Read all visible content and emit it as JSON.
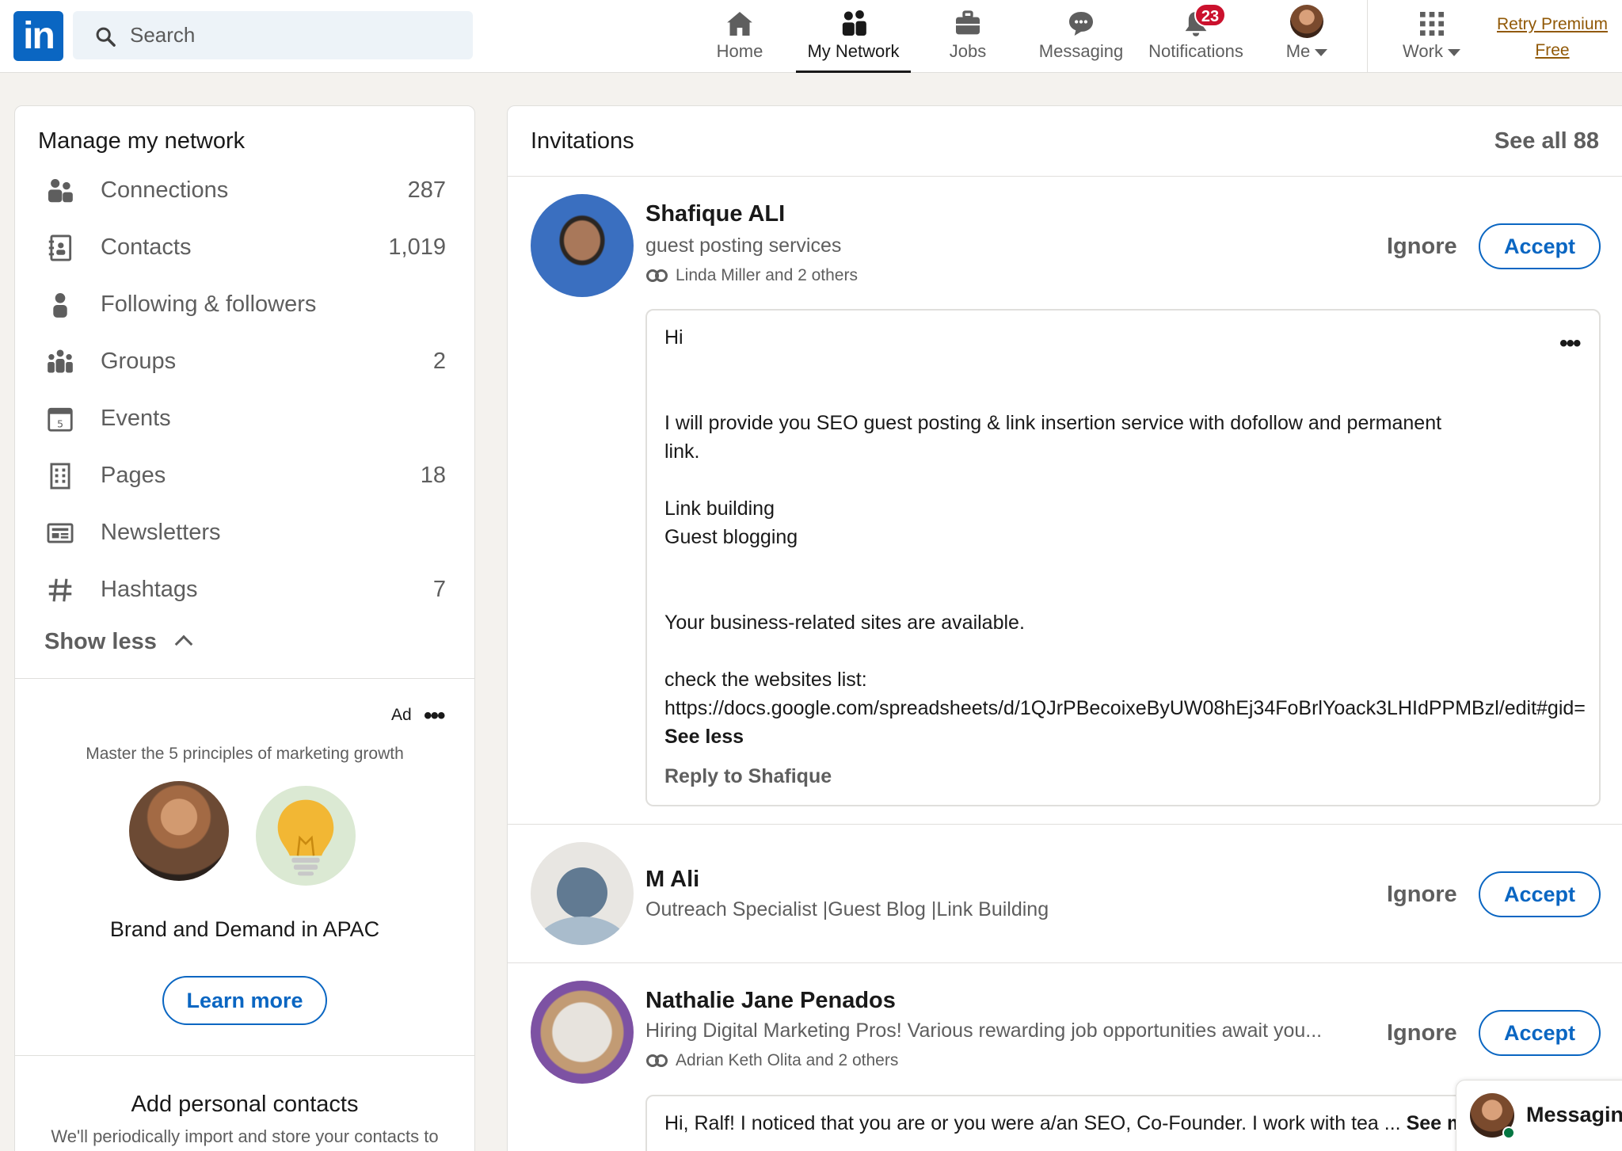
{
  "colors": {
    "brand": "#0a66c2",
    "badge": "#cb112d",
    "premium": "#915907",
    "background": "#f4f2ee"
  },
  "header": {
    "logo": "in",
    "search_placeholder": "Search",
    "nav": [
      {
        "label": "Home",
        "icon": "home-icon"
      },
      {
        "label": "My Network",
        "icon": "network-icon",
        "active": true
      },
      {
        "label": "Jobs",
        "icon": "briefcase-icon"
      },
      {
        "label": "Messaging",
        "icon": "chat-icon"
      },
      {
        "label": "Notifications",
        "icon": "bell-icon",
        "badge": "23"
      },
      {
        "label": "Me",
        "icon": "avatar"
      },
      {
        "label": "Work",
        "icon": "grid-icon"
      }
    ],
    "premium": {
      "line1": "Retry Premium",
      "line2": "Free"
    }
  },
  "sidebar": {
    "title": "Manage my network",
    "items": [
      {
        "label": "Connections",
        "count": "287",
        "icon": "people-icon"
      },
      {
        "label": "Contacts",
        "count": "1,019",
        "icon": "contact-book-icon"
      },
      {
        "label": "Following & followers",
        "count": "",
        "icon": "person-icon"
      },
      {
        "label": "Groups",
        "count": "2",
        "icon": "group-icon"
      },
      {
        "label": "Events",
        "count": "",
        "icon": "calendar-icon"
      },
      {
        "label": "Pages",
        "count": "18",
        "icon": "building-icon"
      },
      {
        "label": "Newsletters",
        "count": "",
        "icon": "newspaper-icon"
      },
      {
        "label": "Hashtags",
        "count": "7",
        "icon": "hashtag-icon"
      }
    ],
    "show_less": "Show less",
    "ad": {
      "label": "Ad",
      "headline": "Master the 5 principles of marketing growth",
      "brand": "Brand and Demand in APAC",
      "cta": "Learn more"
    },
    "contacts_title": "Add personal contacts",
    "contacts_sub": "We'll periodically import and store your contacts to"
  },
  "invitations": {
    "title": "Invitations",
    "see_all": "See all 88",
    "ignore_label": "Ignore",
    "accept_label": "Accept",
    "items": [
      {
        "name": "Shafique ALI",
        "headline": "guest posting services",
        "mutual": "Linda Miller and 2 others",
        "message": {
          "lines": [
            "Hi",
            "I will provide you SEO guest posting & link insertion service with dofollow and permanent",
            "link.",
            "Link building",
            "Guest blogging",
            "Your business-related sites are available.",
            "check the websites list:",
            "https://docs.google.com/spreadsheets/d/1QJrPBecoixeByUW08hEj34FoBrlYoack3LHIdPPMBzl/edit#gid="
          ],
          "see_less": "See less",
          "reply": "Reply to Shafique"
        }
      },
      {
        "name": "M Ali",
        "headline": "Outreach Specialist |Guest Blog |Link Building",
        "mutual": ""
      },
      {
        "name": "Nathalie Jane Penados",
        "headline": "Hiring Digital Marketing Pros! Various rewarding job opportunities await you...",
        "mutual": "Adrian Keth Olita and 2 others",
        "message": {
          "preview": "Hi, Ralf! I noticed that you are or you were a/an SEO, Co-Founder. I work with tea ...",
          "see_more": "See more"
        }
      }
    ]
  },
  "messaging": {
    "label": "Messaging"
  }
}
